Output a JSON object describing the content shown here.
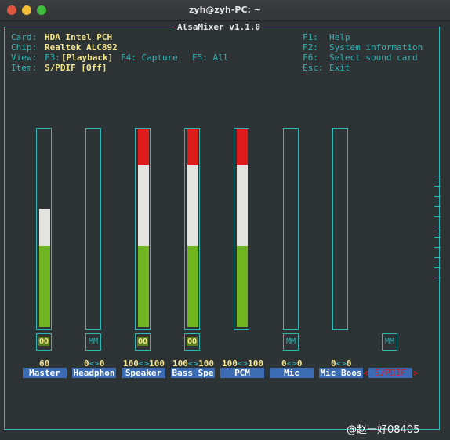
{
  "window": {
    "title": "zyh@zyh-PC: ~"
  },
  "app": {
    "title": "AlsaMixer v1.1.0"
  },
  "info": {
    "card_label": "Card:",
    "card_value": "HDA Intel PCH",
    "chip_label": "Chip:",
    "chip_value": "Realtek ALC892",
    "view_label": "View:",
    "view_f3": "F3:",
    "view_current": "[Playback]",
    "view_f4": "F4: Capture",
    "view_f5": "F5: All",
    "item_label": "Item:",
    "item_value": "S/PDIF [Off]"
  },
  "help": {
    "f1_key": "F1:",
    "f1_text": "Help",
    "f2_key": "F2:",
    "f2_text": "System information",
    "f6_key": "F6:",
    "f6_text": "Select sound card",
    "esc_key": "Esc:",
    "esc_text": "Exit"
  },
  "channels": [
    {
      "name": "Master",
      "level": 60,
      "left_vol": "60",
      "sep": "",
      "right_vol": "",
      "switch": "OO",
      "muted": false
    },
    {
      "name": "Headphon",
      "level": 0,
      "left_vol": "0",
      "sep": "<>",
      "right_vol": "0",
      "switch": "MM",
      "muted": true
    },
    {
      "name": "Speaker",
      "level": 100,
      "left_vol": "100",
      "sep": "<>",
      "right_vol": "100",
      "switch": "OO",
      "muted": false
    },
    {
      "name": "Bass Spe",
      "level": 100,
      "left_vol": "100",
      "sep": "<>",
      "right_vol": "100",
      "switch": "OO",
      "muted": false
    },
    {
      "name": "PCM",
      "level": 100,
      "left_vol": "100",
      "sep": "<>",
      "right_vol": "100",
      "switch": "",
      "muted": false
    },
    {
      "name": "Mic",
      "level": 0,
      "left_vol": "0",
      "sep": "<>",
      "right_vol": "0",
      "switch": "MM",
      "muted": true
    },
    {
      "name": "Mic Boos",
      "level": 0,
      "left_vol": "0",
      "sep": "<>",
      "right_vol": "0",
      "switch": "",
      "muted": false
    },
    {
      "name": "S/PDIF",
      "level": null,
      "left_vol": "",
      "sep": "",
      "right_vol": "",
      "switch": "MM",
      "muted": true,
      "selected": true
    }
  ],
  "watermark": "@赵一好08405",
  "colors": {
    "cyan": "#2fb5b5",
    "yellow": "#f2e58e",
    "green": "#6fb51f",
    "white": "#e3e3df",
    "red": "#e01b1b",
    "blue": "#3a6bb3"
  }
}
